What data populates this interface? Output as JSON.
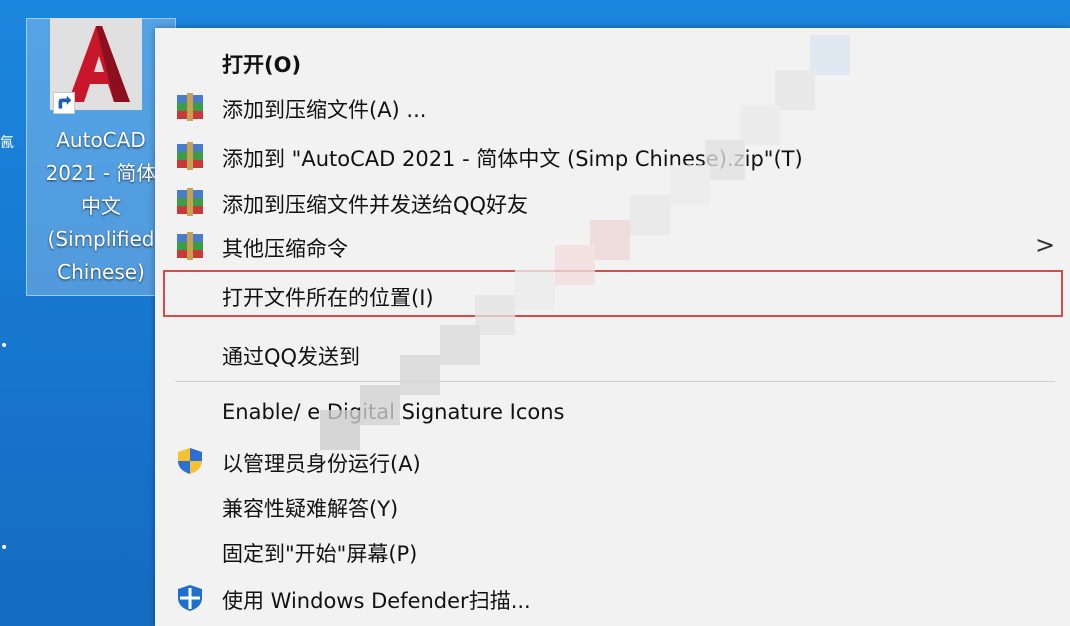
{
  "desktop": {
    "shortcut": {
      "caption": "AutoCAD\n2021 - 简体\n中文\n(Simplified\nChinese)"
    },
    "edge_glyphs": [
      "氥",
      "•",
      "•"
    ]
  },
  "context_menu": {
    "items": [
      {
        "label": "打开(O)"
      },
      {
        "label": "添加到压缩文件(A) ..."
      },
      {
        "label": "添加到 \"AutoCAD 2021 - 简体中文 (Simp            Chinese).zip\"(T)"
      },
      {
        "label": "添加到压缩文件并发送给QQ好友"
      },
      {
        "label": "其他压缩命令"
      },
      {
        "label": "打开文件所在的位置(I)"
      },
      {
        "label": "通过QQ发送到"
      },
      {
        "label": "Enable/           e Digital Signature Icons"
      },
      {
        "label": "以管理员身份运行(A)"
      },
      {
        "label": "兼容性疑难解答(Y)"
      },
      {
        "label": "固定到\"开始\"屏幕(P)"
      },
      {
        "label": "使用 Windows Defender扫描..."
      }
    ],
    "submenu_arrow": ">",
    "highlight_color": "#d94a4a"
  },
  "icons": {
    "archive": "winrar-archive-icon",
    "uac": "uac-shield-icon",
    "defender": "windows-defender-icon",
    "app": "autocad-logo-icon",
    "shortcut": "shortcut-arrow-icon"
  }
}
